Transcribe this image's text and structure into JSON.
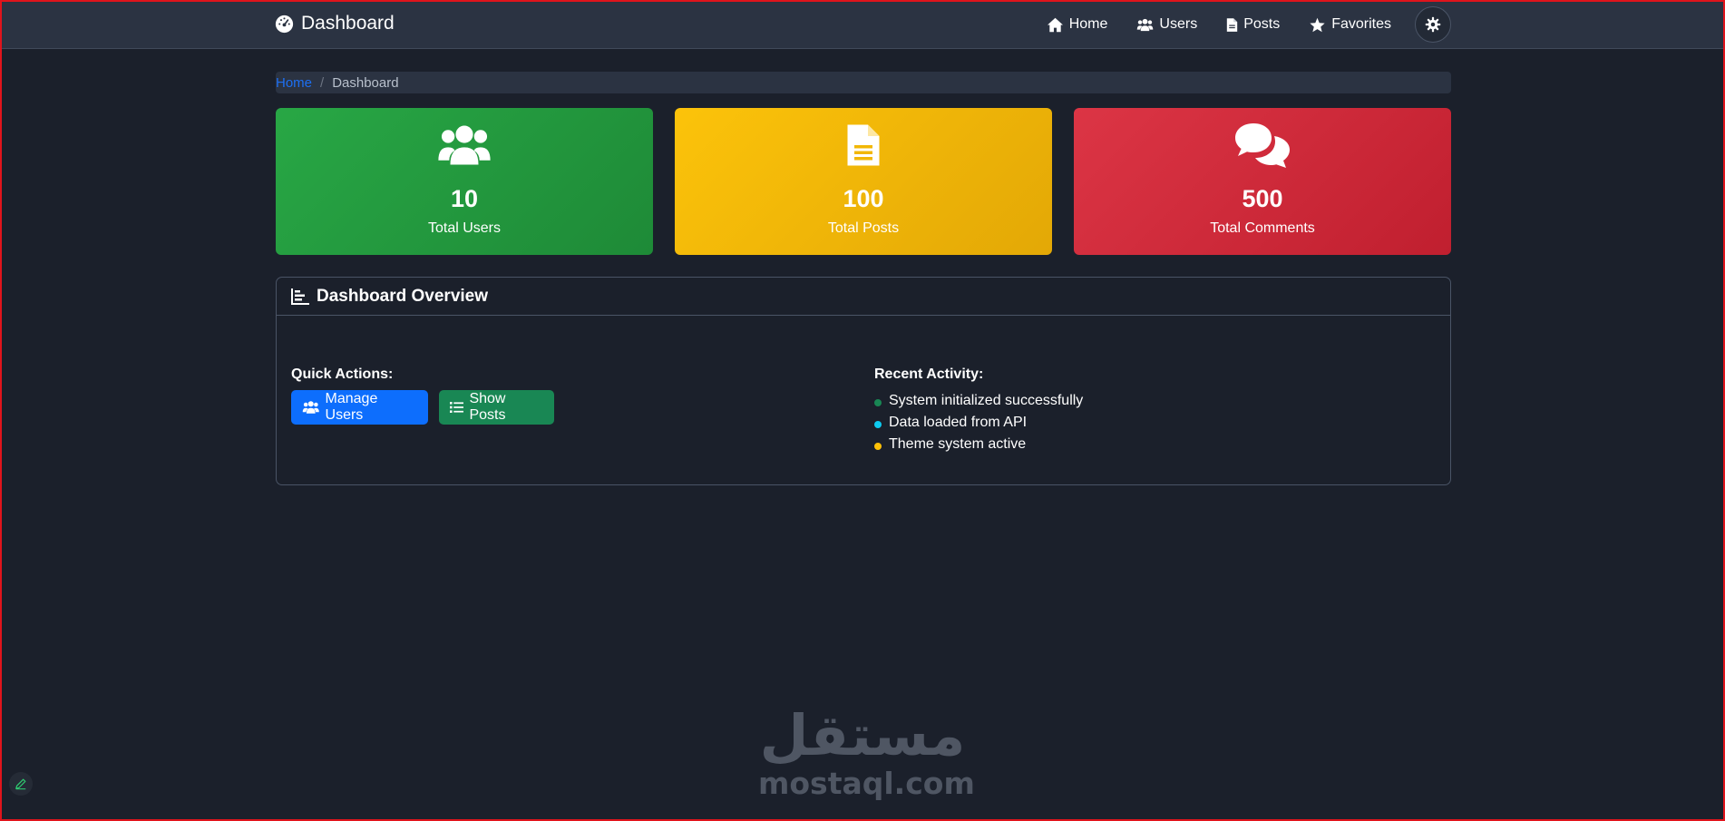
{
  "navbar": {
    "brand": "Dashboard",
    "links": [
      {
        "label": "Home",
        "icon": "home-icon"
      },
      {
        "label": "Users",
        "icon": "users-icon"
      },
      {
        "label": "Posts",
        "icon": "file-icon"
      },
      {
        "label": "Favorites",
        "icon": "star-icon"
      }
    ],
    "theme_toggle_icon": "gear-icon"
  },
  "breadcrumb": {
    "home": "Home",
    "current": "Dashboard"
  },
  "stats": [
    {
      "value": "10",
      "label": "Total Users",
      "icon": "users-icon",
      "color": "#28a745"
    },
    {
      "value": "100",
      "label": "Total Posts",
      "icon": "file-icon",
      "color": "#fcc30a"
    },
    {
      "value": "500",
      "label": "Total Comments",
      "icon": "comments-icon",
      "color": "#dc3545"
    }
  ],
  "overview": {
    "title": "Dashboard Overview",
    "quick_actions_title": "Quick Actions:",
    "buttons": {
      "manage_users": "Manage Users",
      "show_posts": "Show Posts"
    },
    "recent_activity_title": "Recent Activity:",
    "activity": [
      {
        "text": "System initialized successfully",
        "color": "#198754"
      },
      {
        "text": "Data loaded from API",
        "color": "#0dcaf0"
      },
      {
        "text": "Theme system active",
        "color": "#ffc107"
      }
    ]
  },
  "watermark": {
    "arabic": "مستقل",
    "latin": "mostaql.com"
  },
  "colors": {
    "background": "#1b202b",
    "navbar": "#2b3342",
    "link": "#1d6ff2",
    "primary_button": "#0d6efd",
    "success_button": "#198754"
  }
}
